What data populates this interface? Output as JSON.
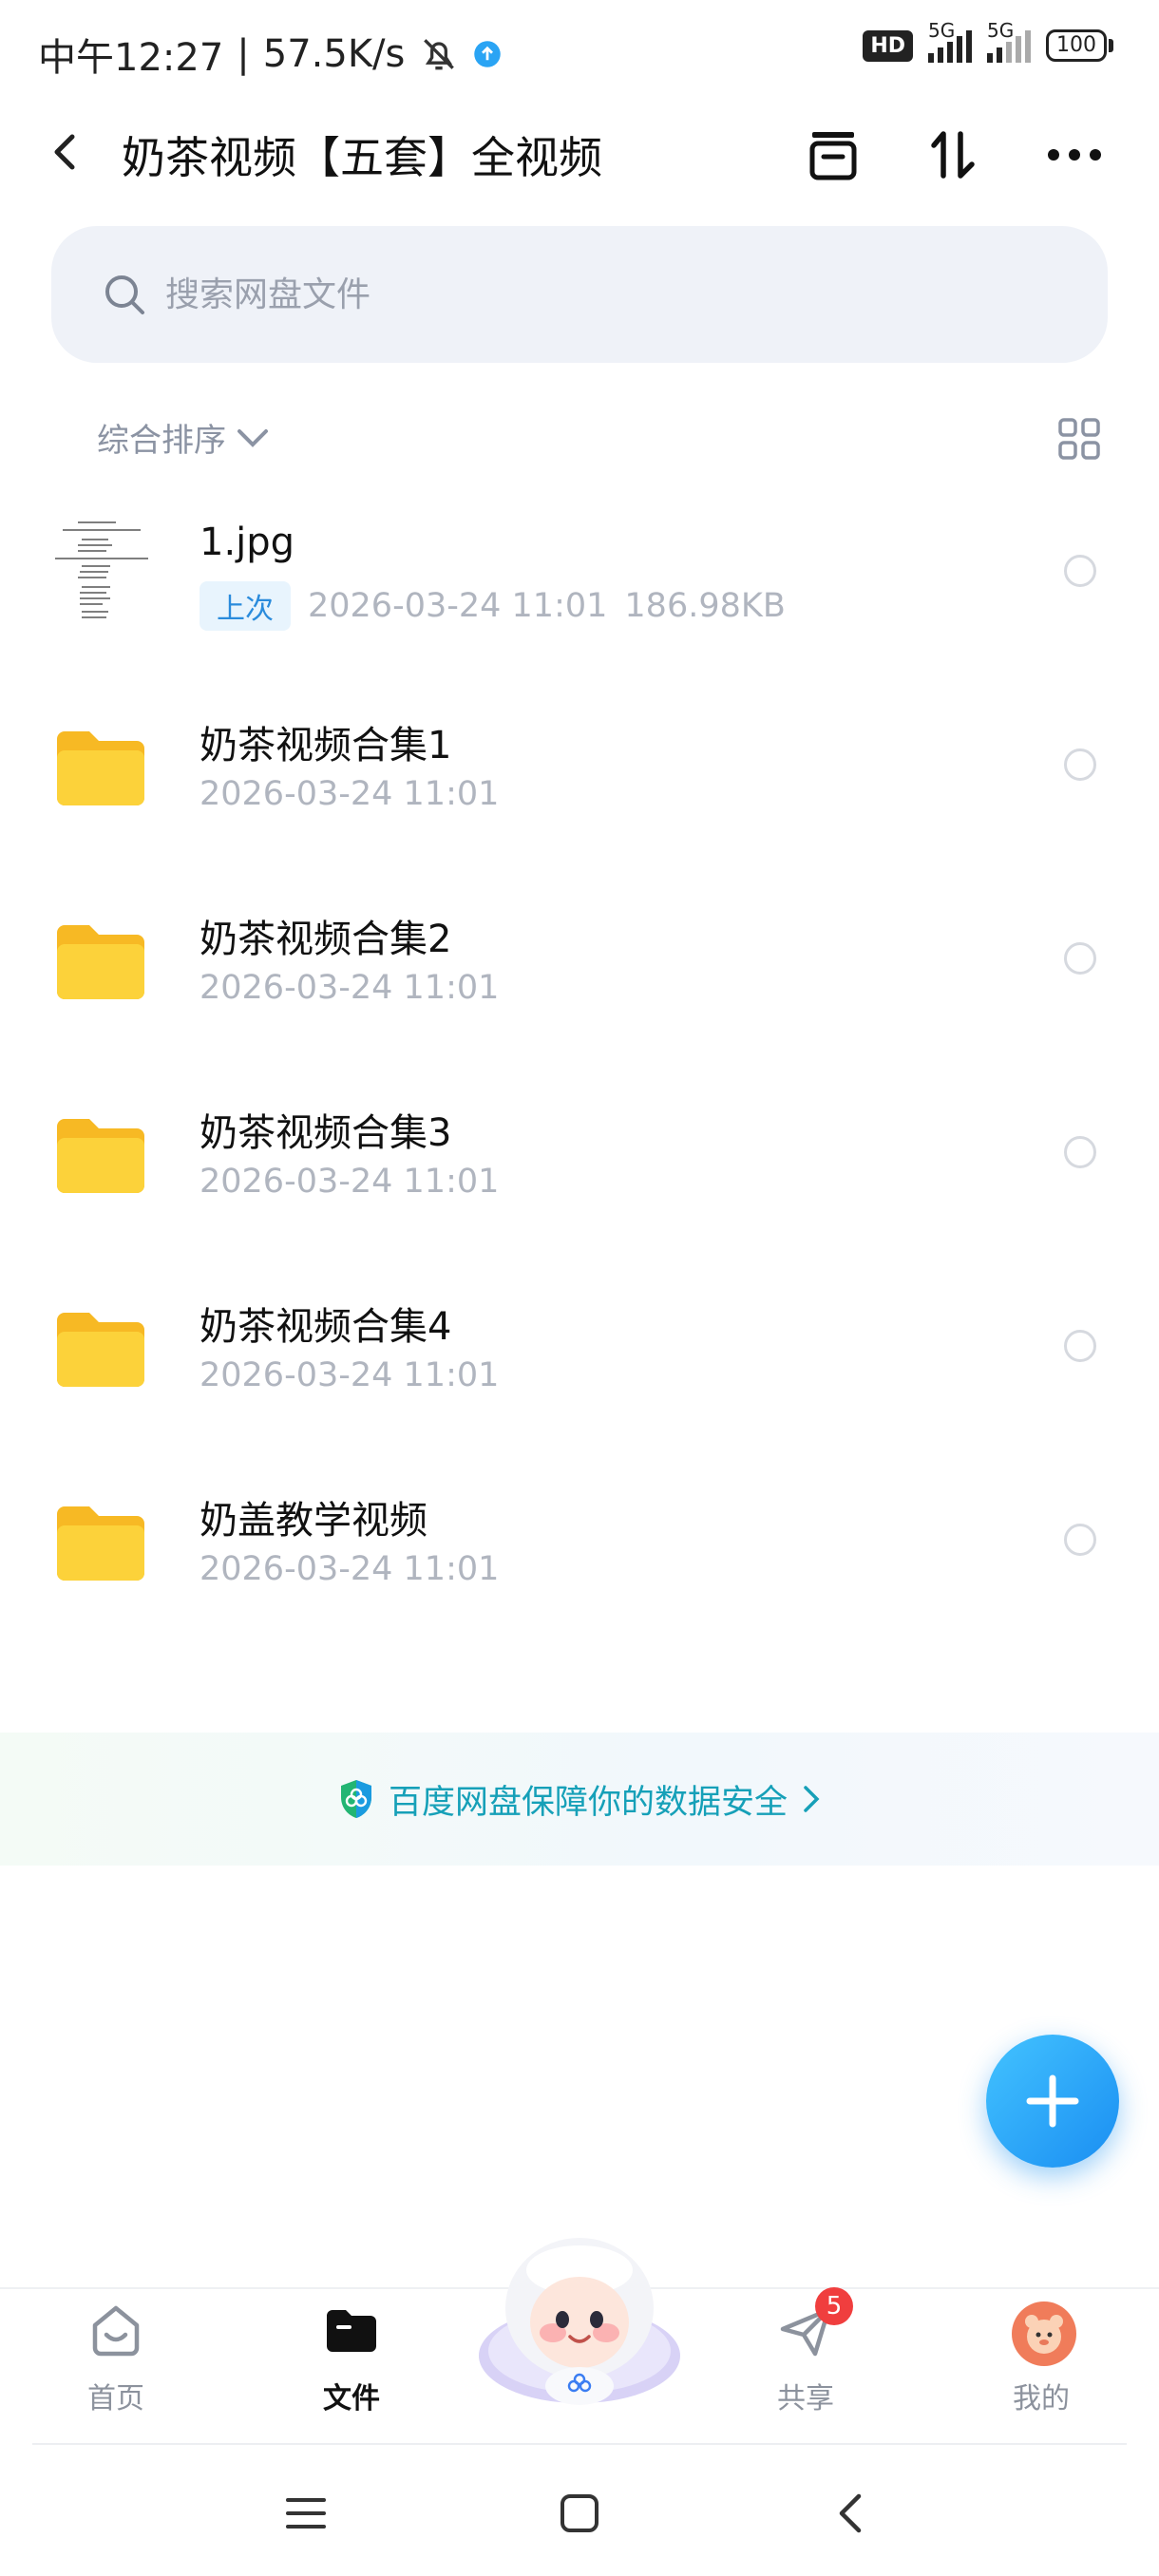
{
  "status_bar": {
    "time": "中午12:27",
    "speed": "57.5K/s",
    "hd": "HD",
    "net1": "5G",
    "net2": "5G",
    "battery": "100"
  },
  "header": {
    "title": "奶茶视频【五套】全视频",
    "icons": [
      "back-icon",
      "archive-icon",
      "sort-icon",
      "more-icon"
    ]
  },
  "search": {
    "placeholder": "搜索网盘文件"
  },
  "sort": {
    "label": "综合排序"
  },
  "files": [
    {
      "name": "1.jpg",
      "badge": "上次",
      "date": "2026-03-24  11:01",
      "size": "186.98KB",
      "type": "image"
    },
    {
      "name": "奶茶视频合集1",
      "date": "2026-03-24  11:01",
      "type": "folder"
    },
    {
      "name": "奶茶视频合集2",
      "date": "2026-03-24  11:01",
      "type": "folder"
    },
    {
      "name": "奶茶视频合集3",
      "date": "2026-03-24  11:01",
      "type": "folder"
    },
    {
      "name": "奶茶视频合集4",
      "date": "2026-03-24  11:01",
      "type": "folder"
    },
    {
      "name": "奶盖教学视频",
      "date": "2026-03-24  11:01",
      "type": "folder"
    }
  ],
  "security_banner": {
    "text": "百度网盘保障你的数据安全"
  },
  "bottom_nav": {
    "items": [
      {
        "label": "首页",
        "icon": "home-icon"
      },
      {
        "label": "文件",
        "icon": "folder-icon",
        "active": true
      },
      {
        "label": "共享",
        "icon": "share-icon",
        "badge": "5"
      },
      {
        "label": "我的",
        "icon": "avatar"
      }
    ]
  },
  "colors": {
    "accent": "#1a8ef2",
    "folder": "#fcc934",
    "badge_red": "#f03e3e",
    "security_text": "#16a0b8"
  }
}
